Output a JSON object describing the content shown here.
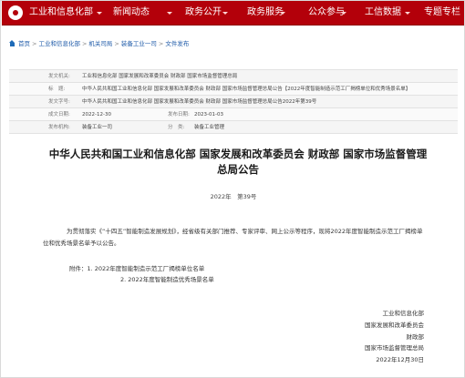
{
  "nav": {
    "items": [
      "工业和信息化部",
      "新闻动态",
      "政务公开",
      "政务服务",
      "公众参与",
      "工信数据",
      "专题专栏"
    ]
  },
  "breadcrumb": [
    "首页",
    "工业和信息化部",
    "机关司局",
    "装备工业一司",
    "文件发布"
  ],
  "meta": {
    "issuer_label": "发文机关:",
    "issuer_value": "工业和信息化部 国家发展和改革委员会 财政部 国家市场监督管理总局",
    "title_label": "标　题:",
    "title_value": "中华人民共和国工业和信息化部 国家发展和改革委员会 财政部 国家市场监督管理总局公告【2022年度智能制造示范工厂揭榜单位和优秀场景名单】",
    "number_label": "发文字号:",
    "number_value": "中华人民共和国工业和信息化部 国家发展和改革委员会 财政部 国家市场监督管理总局公告2022年第39号",
    "date_label": "成文日期:",
    "date_value": "2022-12-30",
    "publish_label": "发布日期:",
    "publish_value": "2023-01-03",
    "org_label": "发布机构:",
    "org_value": "装备工业一司",
    "category_label": "分　类:",
    "category_value": "装备工业管理"
  },
  "document": {
    "title": "中华人民共和国工业和信息化部 国家发展和改革委员会 财政部 国家市场监督管理总局公告",
    "number": "2022年　第39号",
    "paragraph": "为贯彻落实《“十四五”智能制造发展规划》，经省级有关部门推荐、专家评审、网上公示等程序，现将2022年度智能制造示范工厂揭榜单位和优秀场景名单予以公告。",
    "attachment_1": "附件：1. 2022年度智能制造示范工厂揭榜单位名单",
    "attachment_2": "2. 2022年度智能制造优秀场景名单",
    "signatures": [
      "工业和信息化部",
      "国家发展和改革委员会",
      "财政部",
      "国家市场监督管理总局"
    ],
    "sign_date": "2022年12月30日"
  },
  "colors": {
    "nav_bg": "#b3000a",
    "link": "#1e5aa8"
  }
}
